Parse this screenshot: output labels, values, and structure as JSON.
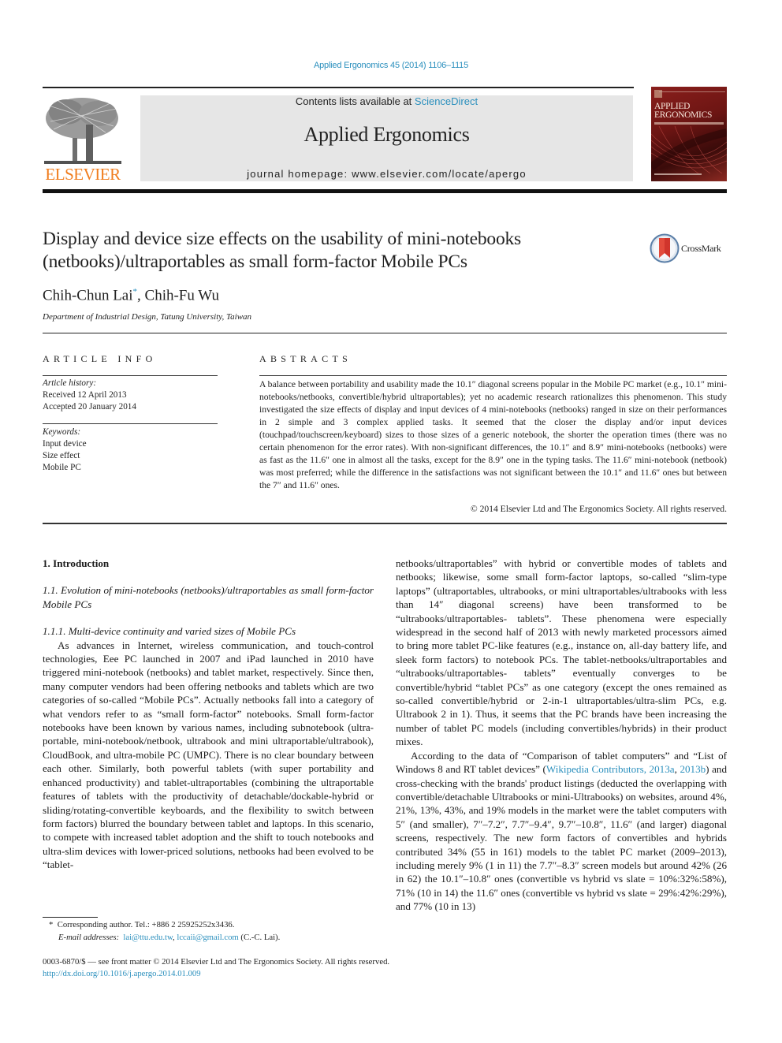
{
  "header": {
    "journal_ref": "Applied Ergonomics 45 (2014) 1106–1115",
    "contents_prefix": "Contents lists available at ",
    "contents_link": "ScienceDirect",
    "journal_title": "Applied Ergonomics",
    "homepage": "journal homepage: www.elsevier.com/locate/apergo",
    "publisher_logo_text": "ELSEVIER",
    "cover": {
      "title_line1": "APPLIED",
      "title_line2": "ERGONOMICS"
    },
    "colors": {
      "link": "#2a8fbd",
      "elsevier_orange": "#f07d1e",
      "masthead_bg": "#e6e6e6",
      "cover_red": "#8a1f1c"
    }
  },
  "article": {
    "title": "Display and device size effects on the usability of mini-notebooks (netbooks)/ultraportables as small form-factor Mobile PCs",
    "crossmark_label": "CrossMark",
    "authors": [
      {
        "name": "Chih-Chun Lai",
        "mark": "*"
      },
      {
        "name": "Chih-Fu Wu",
        "mark": ""
      }
    ],
    "author_separator": ", ",
    "affiliation": "Department of Industrial Design, Tatung University, Taiwan"
  },
  "article_info": {
    "heading": "ARTICLE INFO",
    "history_label": "Article history:",
    "received": "Received 12 April 2013",
    "accepted": "Accepted 20 January 2014",
    "keywords_label": "Keywords:",
    "keywords": [
      "Input device",
      "Size effect",
      "Mobile PC"
    ]
  },
  "abstract": {
    "heading": "ABSTRACTS",
    "text": "A balance between portability and usability made the 10.1″ diagonal screens popular in the Mobile PC market (e.g., 10.1″ mini-notebooks/netbooks, convertible/hybrid ultraportables); yet no academic research rationalizes this phenomenon. This study investigated the size effects of display and input devices of 4 mini-notebooks (netbooks) ranged in size on their performances in 2 simple and 3 complex applied tasks. It seemed that the closer the display and/or input devices (touchpad/touchscreen/keyboard) sizes to those sizes of a generic notebook, the shorter the operation times (there was no certain phenomenon for the error rates). With non-significant differences, the 10.1″ and 8.9″ mini-notebooks (netbooks) were as fast as the 11.6″ one in almost all the tasks, except for the 8.9″ one in the typing tasks. The 11.6″ mini-notebook (netbook) was most preferred; while the difference in the satisfactions was not significant between the 10.1″ and 11.6″ ones but between the 7″ and 11.6″ ones.",
    "copyright": "© 2014 Elsevier Ltd and The Ergonomics Society. All rights reserved."
  },
  "body": {
    "section_heading": "1.  Introduction",
    "subsection_heading": "1.1.  Evolution of mini-notebooks (netbooks)/ultraportables as small form-factor Mobile PCs",
    "subsubsection_heading": "1.1.1.  Multi-device continuity and varied sizes of Mobile PCs",
    "left_paragraph": "As advances in Internet, wireless communication, and touch-control technologies, Eee PC launched in 2007 and iPad launched in 2010 have triggered mini-notebook (netbooks) and tablet market, respectively. Since then, many computer vendors had been offering netbooks and tablets which are two categories of so-called “Mobile PCs”. Actually netbooks fall into a category of what vendors refer to as “small form-factor” notebooks. Small form-factor notebooks have been known by various names, including subnotebook (ultra-portable, mini-notebook/netbook, ultrabook and mini ultraportable/ultrabook), CloudBook, and ultra-mobile PC (UMPC). There is no clear boundary between each other. Similarly, both powerful tablets (with super portability and enhanced productivity) and tablet-ultraportables (combining the ultraportable features of tablets with the productivity of detachable/dockable-hybrid or sliding/rotating-convertible keyboards, and the flexibility to switch between form factors) blurred the boundary between tablet and laptops. In this scenario, to compete with increased tablet adoption and the shift to touch notebooks and ultra-slim devices with lower-priced solutions, netbooks had been evolved to be “tablet-",
    "right_paragraph_1": "netbooks/ultraportables” with hybrid or convertible modes of tablets and netbooks; likewise, some small form-factor laptops, so-called “slim-type laptops” (ultraportables, ultrabooks, or mini ultraportables/ultrabooks with less than 14″ diagonal screens) have been transformed to be “ultrabooks/ultraportables- tablets”. These phenomena were especially widespread in the second half of 2013 with newly marketed processors aimed to bring more tablet PC-like features (e.g., instance on, all-day battery life, and sleek form factors) to notebook PCs. The tablet-netbooks/ultraportables and “ultrabooks/ultraportables- tablets” eventually converges to be convertible/hybrid “tablet PCs” as one category (except the ones remained as so-called convertible/hybrid or 2-in-1 ultraportables/ultra-slim PCs, e.g. Ultrabook 2 in 1). Thus, it seems that the PC brands have been increasing the number of tablet PC models (including convertibles/hybrids) in their product mixes.",
    "right_paragraph_2_before": "According to the data of “Comparison of tablet computers” and “List of Windows 8 and RT tablet devices” (",
    "right_paragraph_2_link1": "Wikipedia Contributors, 2013a",
    "right_paragraph_2_sep": ", ",
    "right_paragraph_2_link2": "2013b",
    "right_paragraph_2_after": ") and cross-checking with the brands' product listings (deducted the overlapping with convertible/detachable Ultrabooks or mini-Ultrabooks) on websites, around 4%, 21%, 13%, 43%, and 19% models in the market were the tablet computers with 5″ (and smaller), 7″–7.2″, 7.7″–9.4″, 9.7″–10.8″, 11.6″ (and larger) diagonal screens, respectively. The new form factors of convertibles and hybrids contributed 34% (55 in 161) models to the tablet PC market (2009–2013), including merely 9% (1 in 11) the 7.7″–8.3″ screen models but around 42% (26 in 62) the 10.1″–10.8″ ones (convertible vs hybrid vs slate = 10%:32%:58%), 71% (10 in 14) the 11.6″ ones (convertible vs hybrid vs slate = 29%:42%:29%), and 77% (10 in 13)"
  },
  "footnote": {
    "mark": "*",
    "corresponding": "Corresponding author. Tel.: +886 2 25925252x3436.",
    "email_label": "E-mail addresses:",
    "email1": "lai@ttu.edu.tw",
    "email_sep": ", ",
    "email2": "lccaii@gmail.com",
    "email_suffix": " (C.-C. Lai)."
  },
  "front_matter": {
    "issn_line": "0003-6870/$ — see front matter © 2014 Elsevier Ltd and The Ergonomics Society. All rights reserved.",
    "doi": "http://dx.doi.org/10.1016/j.apergo.2014.01.009"
  }
}
